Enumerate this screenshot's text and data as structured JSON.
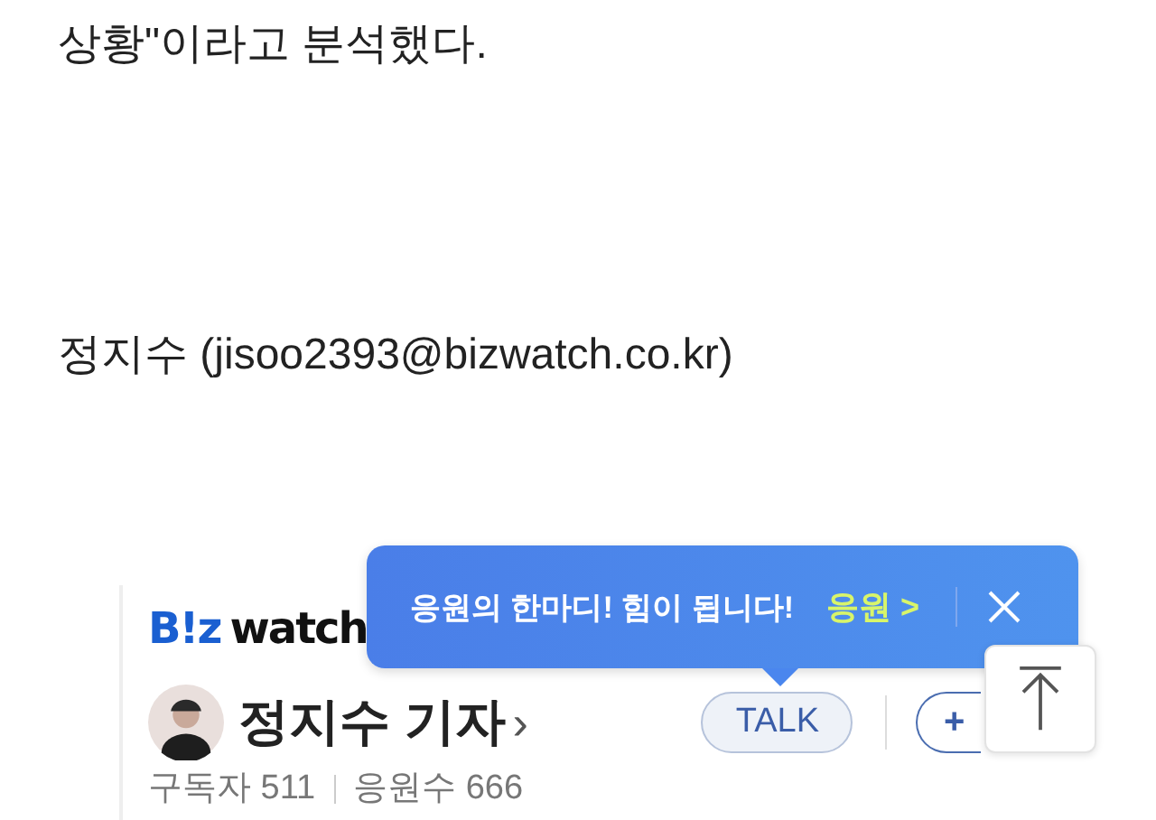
{
  "article": {
    "last_line": "상황\"이라고 분석했다.",
    "byline": "정지수 (jisoo2393@bizwatch.co.kr)"
  },
  "reporter_card": {
    "logo_mark": "B!z",
    "logo_word": "watch",
    "name": "정지수 기자",
    "chevron": "›",
    "talk_button": "TALK",
    "subscribe_button": "+",
    "stats": [
      {
        "label": "구독자",
        "value": "511"
      },
      {
        "label": "응원수",
        "value": "666"
      }
    ]
  },
  "tooltip": {
    "message": "응원의 한마디! 힘이 됩니다!",
    "action": "응원 >"
  }
}
